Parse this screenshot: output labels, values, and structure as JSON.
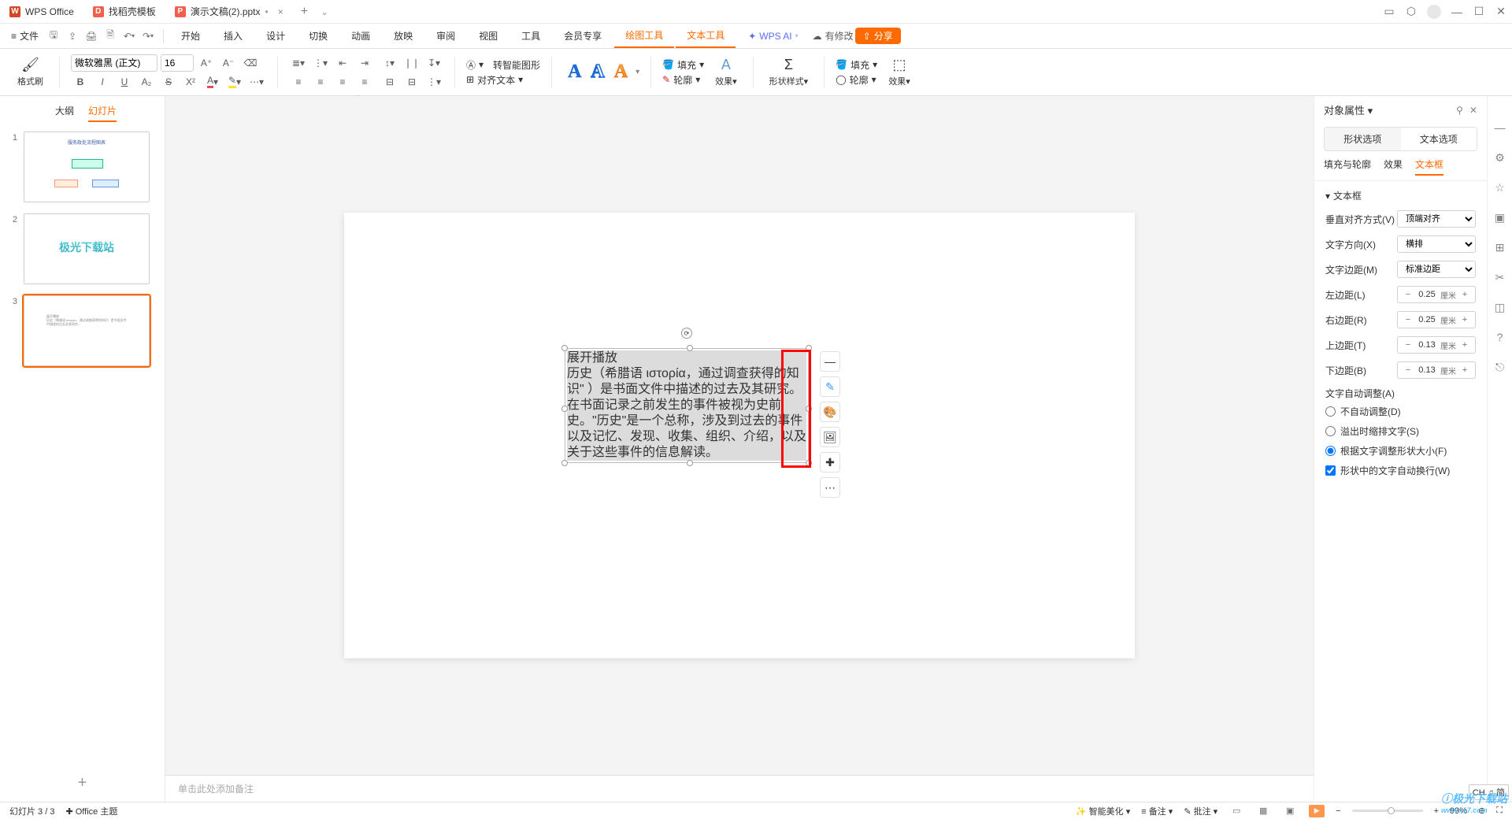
{
  "titlebar": {
    "app_name": "WPS Office",
    "tab2": "找稻壳模板",
    "tab3": "演示文稿(2).pptx"
  },
  "menubar": {
    "file": "文件",
    "tabs": [
      "开始",
      "插入",
      "设计",
      "切换",
      "动画",
      "放映",
      "审阅",
      "视图",
      "工具",
      "会员专享",
      "绘图工具",
      "文本工具"
    ],
    "ai": "WPS AI",
    "has_changes": "有修改",
    "share": "分享"
  },
  "ribbon": {
    "format_painter": "格式刷",
    "font_name": "微软雅黑 (正文)",
    "font_size": "16",
    "smart_shape": "转智能图形",
    "align_text": "对齐文本",
    "fill": "填充",
    "outline": "轮廓",
    "effect": "效果",
    "shape_style": "形状样式",
    "fill2": "填充",
    "outline2": "轮廓",
    "effect2": "效果"
  },
  "slidepanel": {
    "outline_tab": "大纲",
    "slides_tab": "幻灯片"
  },
  "slide_text": {
    "line1": "展开播放",
    "body": "历史（希腊语 ιστορία，通过调查获得的知识\" ）是书面文件中描述的过去及其研究。在书面记录之前发生的事件被视为史前史。\"历史\"是一个总称，涉及到过去的事件以及记忆、发现、收集、组织、介绍，以及关于这些事件的信息解读。"
  },
  "notes_placeholder": "单击此处添加备注",
  "props": {
    "title": "对象属性",
    "tab_shape": "形状选项",
    "tab_text": "文本选项",
    "mt_fill": "填充与轮廓",
    "mt_effect": "效果",
    "mt_textbox": "文本框",
    "section_textbox": "文本框",
    "valign_label": "垂直对齐方式(V)",
    "valign_value": "顶端对齐",
    "dir_label": "文字方向(X)",
    "dir_value": "横排",
    "margin_label": "文字边距(M)",
    "margin_value": "标准边距",
    "left_label": "左边距(L)",
    "left_val": "0.25",
    "right_label": "右边距(R)",
    "right_val": "0.25",
    "top_label": "上边距(T)",
    "top_val": "0.13",
    "bottom_label": "下边距(B)",
    "bottom_val": "0.13",
    "unit": "厘米",
    "autofit_label": "文字自动调整(A)",
    "opt_none": "不自动调整(D)",
    "opt_shrink": "溢出时缩排文字(S)",
    "opt_resize": "根据文字调整形状大小(F)",
    "wrap": "形状中的文字自动换行(W)"
  },
  "status": {
    "slide_count": "幻灯片 3 / 3",
    "theme": "Office 主题",
    "beautify": "智能美化",
    "notes": "备注",
    "comments": "批注",
    "zoom": "99%"
  },
  "ime": "CH ♫ 简"
}
